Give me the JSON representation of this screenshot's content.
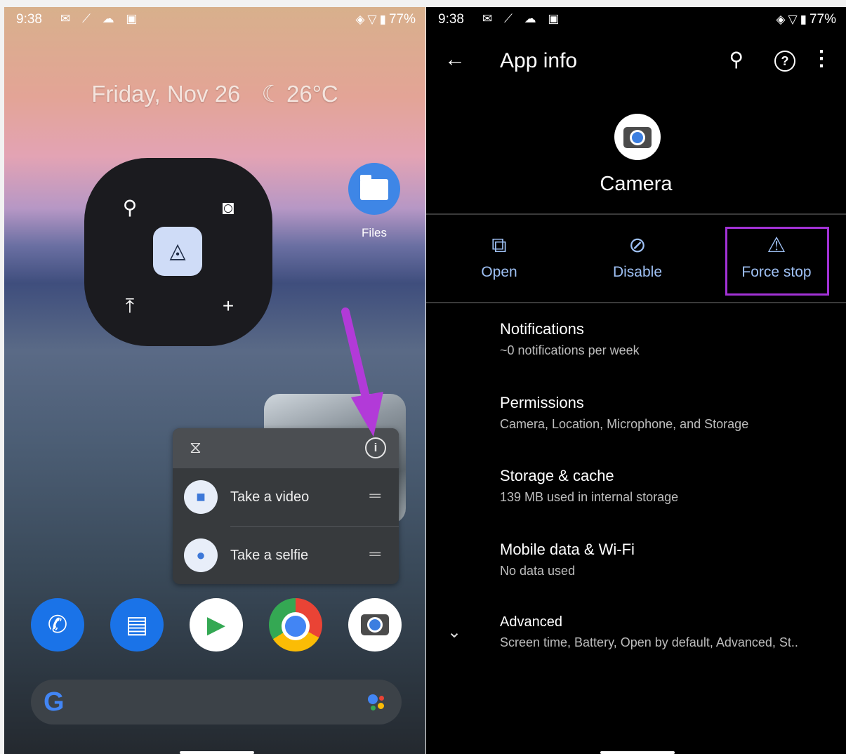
{
  "status_bar": {
    "time": "9:38",
    "battery": "77%"
  },
  "home": {
    "date": "Friday, Nov 26",
    "weather": "26°C",
    "files_label": "Files",
    "shortcuts": [
      {
        "label": "Take a video"
      },
      {
        "label": "Take a selfie"
      }
    ]
  },
  "app_info": {
    "title": "App info",
    "app_name": "Camera",
    "actions": {
      "open": "Open",
      "disable": "Disable",
      "force_stop": "Force stop"
    },
    "rows": [
      {
        "title": "Notifications",
        "subtitle": "~0 notifications per week"
      },
      {
        "title": "Permissions",
        "subtitle": "Camera, Location, Microphone, and Storage"
      },
      {
        "title": "Storage & cache",
        "subtitle": "139 MB used in internal storage"
      },
      {
        "title": "Mobile data & Wi-Fi",
        "subtitle": "No data used"
      },
      {
        "title": "Advanced",
        "subtitle": "Screen time, Battery, Open by default, Advanced, St.."
      }
    ]
  },
  "colors": {
    "accent": "#9fc1f5",
    "highlight": "#a232d6",
    "arrow": "#b23ad8"
  }
}
